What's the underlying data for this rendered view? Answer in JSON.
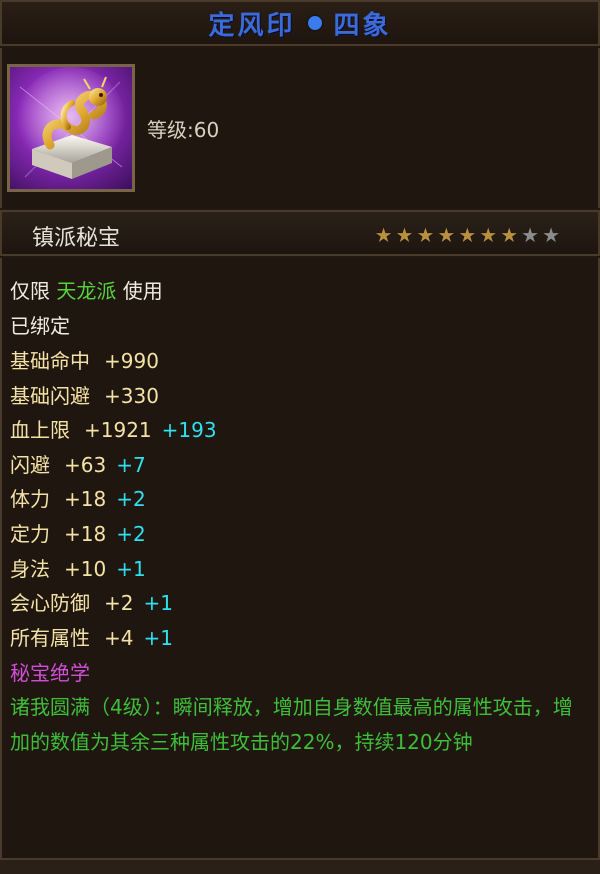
{
  "title": {
    "name": "定风印",
    "variant": "四象"
  },
  "item": {
    "icon": "golden-dragon-seal-icon",
    "level_label": "等级:60",
    "type_label": "镇派秘宝",
    "stars_filled": 7,
    "stars_total": 9
  },
  "restriction": {
    "prefix": "仅限",
    "sect": "天龙派",
    "suffix": "使用"
  },
  "bind_status": "已绑定",
  "stats": [
    {
      "name": "基础命中",
      "value": "+990",
      "extra": ""
    },
    {
      "name": "基础闪避",
      "value": "+330",
      "extra": ""
    },
    {
      "name": "血上限",
      "value": "+1921",
      "extra": "+193"
    },
    {
      "name": "闪避",
      "value": "+63",
      "extra": "+7"
    },
    {
      "name": "体力",
      "value": "+18",
      "extra": "+2"
    },
    {
      "name": "定力",
      "value": "+18",
      "extra": "+2"
    },
    {
      "name": "身法",
      "value": "+10",
      "extra": "+1"
    },
    {
      "name": "会心防御",
      "value": "+2",
      "extra": "+1"
    },
    {
      "name": "所有属性",
      "value": "+4",
      "extra": "+1"
    }
  ],
  "skill": {
    "heading": "秘宝绝学",
    "description": "诸我圆满（4级）：瞬间释放，增加自身数值最高的属性攻击，增加的数值为其余三种属性攻击的22%，持续120分钟"
  },
  "colors": {
    "title": "#3a6bd8",
    "sect": "#56d23e",
    "stat": "#f4e2a6",
    "bonus": "#2ee0f0",
    "skill_heading": "#d24ed8",
    "skill_text": "#3fbe3a"
  }
}
